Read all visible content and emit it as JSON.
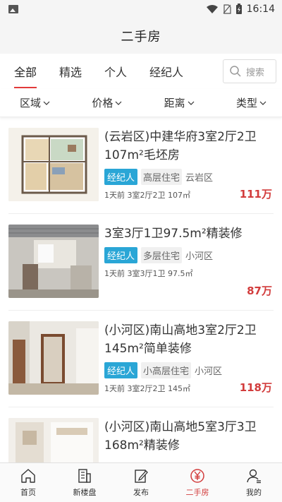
{
  "status_bar": {
    "time": "16:14"
  },
  "header": {
    "title": "二手房"
  },
  "tabs": [
    {
      "label": "全部",
      "active": true
    },
    {
      "label": "精选",
      "active": false
    },
    {
      "label": "个人",
      "active": false
    },
    {
      "label": "经纪人",
      "active": false
    }
  ],
  "search": {
    "placeholder": "搜索"
  },
  "filters": [
    {
      "label": "区域"
    },
    {
      "label": "价格"
    },
    {
      "label": "距离"
    },
    {
      "label": "类型"
    }
  ],
  "listings": [
    {
      "title": "(云岩区)中建华府3室2厅2卫107m²毛坯房",
      "agent_tag": "经纪人",
      "building_type": "高层住宅",
      "district": "云岩区",
      "meta": "1天前  3室2厅2卫  107㎡",
      "price": "111万"
    },
    {
      "title": "3室3厅1卫97.5m²精装修",
      "agent_tag": "经纪人",
      "building_type": "多层住宅",
      "district": "小河区",
      "meta": "1天前  3室3厅1卫  97.5㎡",
      "price": "87万"
    },
    {
      "title": "(小河区)南山高地3室2厅2卫145m²简单装修",
      "agent_tag": "经纪人",
      "building_type": "小高层住宅",
      "district": "小河区",
      "meta": "1天前  3室2厅2卫  145㎡",
      "price": "118万"
    },
    {
      "title": "(小河区)南山高地5室3厅3卫168m²精装修",
      "agent_tag": "",
      "building_type": "",
      "district": "",
      "meta": "",
      "price": ""
    }
  ],
  "bottom_nav": [
    {
      "label": "首页",
      "icon": "home-icon",
      "active": false
    },
    {
      "label": "新楼盘",
      "icon": "building-icon",
      "active": false
    },
    {
      "label": "发布",
      "icon": "edit-icon",
      "active": false
    },
    {
      "label": "二手房",
      "icon": "yuan-icon",
      "active": true
    },
    {
      "label": "我的",
      "icon": "user-icon",
      "active": false
    }
  ],
  "colors": {
    "accent": "#d23c3c",
    "agent_tag": "#2aa6d6"
  }
}
